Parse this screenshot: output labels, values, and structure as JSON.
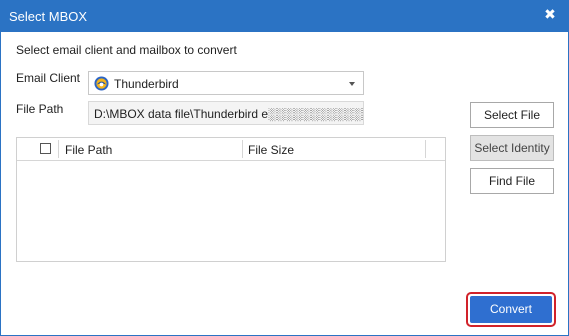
{
  "window": {
    "title": "Select MBOX",
    "close_glyph": "✖"
  },
  "instruction": "Select email client and mailbox to convert",
  "email_client": {
    "label": "Email Client",
    "value": "Thunderbird",
    "icon": "thunderbird-icon"
  },
  "file_path": {
    "label": "File Path",
    "value": "D:\\MBOX data file\\Thunderbird e░░░░░░░░░░░░.1swt02ol.d"
  },
  "grid": {
    "columns": [
      "File Path",
      "File Size"
    ],
    "rows": []
  },
  "buttons": {
    "select_file": "Select File",
    "select_identity": "Select Identity",
    "find_file": "Find File",
    "convert": "Convert"
  },
  "colors": {
    "titlebar": "#2b73c4",
    "convert": "#2f6fd0",
    "highlight": "#d1222a"
  }
}
